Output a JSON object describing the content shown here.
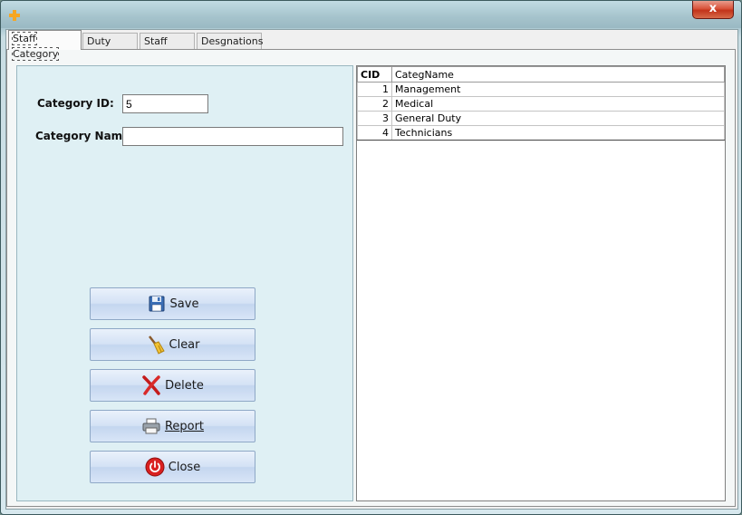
{
  "window": {
    "icon": "plus-icon",
    "close_label": "x"
  },
  "tabs": [
    {
      "label": "Staff Category",
      "active": true
    },
    {
      "label": "Duty Type",
      "active": false
    },
    {
      "label": "Staff Type",
      "active": false
    },
    {
      "label": "Desgnations",
      "active": false
    }
  ],
  "form": {
    "category_id_label": "Category ID:",
    "category_id_value": "5",
    "category_name_label": "Category Name:",
    "category_name_value": ""
  },
  "buttons": {
    "save": {
      "label": "Save",
      "icon": "floppy-disk-icon"
    },
    "clear": {
      "label": "Clear",
      "icon": "broom-icon"
    },
    "delete": {
      "label": "Delete",
      "icon": "red-x-icon"
    },
    "report": {
      "label": "Report",
      "icon": "printer-icon"
    },
    "close": {
      "label": "Close",
      "icon": "power-icon"
    }
  },
  "grid": {
    "columns": [
      "CID",
      "CategName"
    ],
    "rows": [
      {
        "cid": "1",
        "name": "Management"
      },
      {
        "cid": "2",
        "name": "Medical"
      },
      {
        "cid": "3",
        "name": "General Duty"
      },
      {
        "cid": "4",
        "name": "Technicians"
      }
    ]
  },
  "colors": {
    "panel": "#dff0f4",
    "close_button": "#d9533b",
    "button_face": "#d4e2f5"
  }
}
